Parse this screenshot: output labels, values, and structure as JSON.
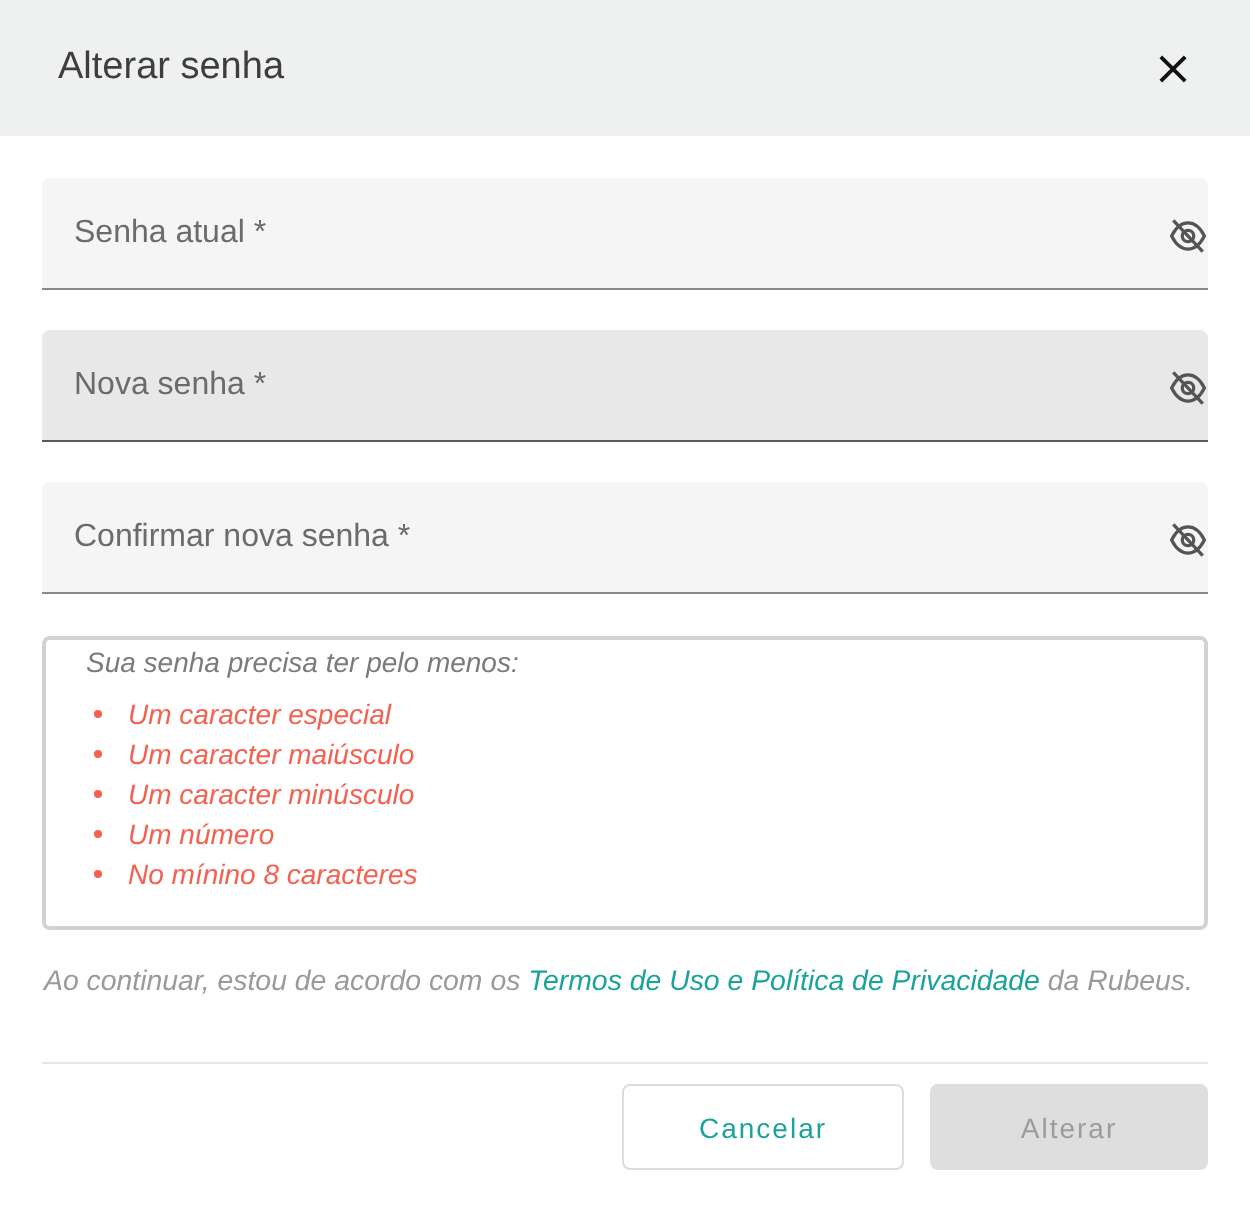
{
  "dialog": {
    "title": "Alterar senha"
  },
  "fields": [
    {
      "label": "Senha atual *",
      "hovered": false
    },
    {
      "label": "Nova senha *",
      "hovered": true
    },
    {
      "label": "Confirmar nova senha *",
      "hovered": false
    }
  ],
  "requirements": {
    "heading": "Sua senha precisa ter pelo menos:",
    "items": [
      {
        "text": "Um caracter especial",
        "met": false
      },
      {
        "text": "Um caracter maiúsculo",
        "met": false
      },
      {
        "text": "Um caracter minúsculo",
        "met": false
      },
      {
        "text": "Um número",
        "met": false
      },
      {
        "text": "No mínino 8 caracteres",
        "met": false
      }
    ]
  },
  "consent": {
    "before": "Ao continuar, estou de acordo com os",
    "link": "Termos de Uso e Política de Privacidade",
    "after": "da Rubeus."
  },
  "buttons": [
    {
      "label": "Cancelar",
      "kind": "secondary",
      "disabled": false
    },
    {
      "label": "Alterar",
      "kind": "primary",
      "disabled": true
    }
  ]
}
